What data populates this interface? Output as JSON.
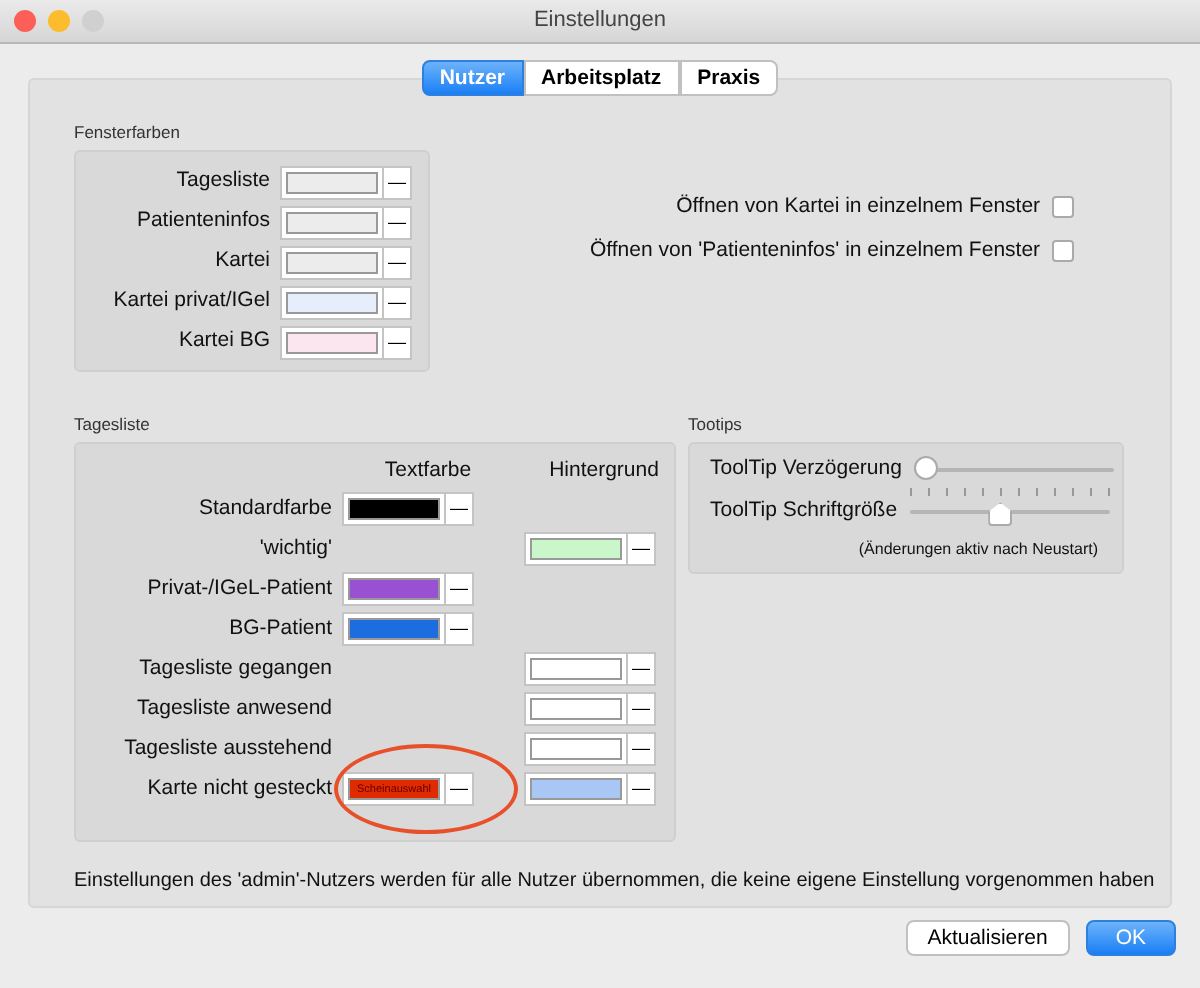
{
  "window": {
    "title": "Einstellungen"
  },
  "tabs": [
    {
      "label": "Nutzer",
      "selected": true
    },
    {
      "label": "Arbeitsplatz",
      "selected": false
    },
    {
      "label": "Praxis",
      "selected": false
    }
  ],
  "fensterfarben": {
    "title": "Fensterfarben",
    "rows": [
      {
        "label": "Tagesliste",
        "color": "#ececec",
        "button": "—"
      },
      {
        "label": "Patienteninfos",
        "color": "#ececec",
        "button": "—"
      },
      {
        "label": "Kartei",
        "color": "#ececec",
        "button": "—"
      },
      {
        "label": "Kartei privat/IGel",
        "color": "#e6eefb",
        "button": "—"
      },
      {
        "label": "Kartei BG",
        "color": "#fbe6ef",
        "button": "—"
      }
    ]
  },
  "options": [
    {
      "label": "Öffnen von Kartei in einzelnem Fenster",
      "checked": false
    },
    {
      "label": "Öffnen von 'Patienteninfos' in einzelnem Fenster",
      "checked": false
    }
  ],
  "tagesliste": {
    "title": "Tagesliste",
    "columns": [
      "Textfarbe",
      "Hintergrund"
    ],
    "rows": [
      {
        "label": "Standardfarbe",
        "text_color": {
          "color": "#000000",
          "button": "—"
        },
        "background": null,
        "circled": false
      },
      {
        "label": "'wichtig'",
        "text_color": null,
        "background": {
          "color": "#c9f7c9",
          "button": "—"
        },
        "circled": false
      },
      {
        "label": "Privat-/IGeL-Patient",
        "text_color": {
          "color": "#9a50d2",
          "button": "—"
        },
        "background": null,
        "circled": false
      },
      {
        "label": "BG-Patient",
        "text_color": {
          "color": "#1c6ee0",
          "button": "—"
        },
        "background": null,
        "circled": false
      },
      {
        "label": "Tagesliste gegangen",
        "text_color": null,
        "background": {
          "color": "#ffffff",
          "button": "—"
        },
        "circled": false
      },
      {
        "label": "Tagesliste anwesend",
        "text_color": null,
        "background": {
          "color": "#ffffff",
          "button": "—"
        },
        "circled": false
      },
      {
        "label": "Tagesliste ausstehend",
        "text_color": null,
        "background": {
          "color": "#ffffff",
          "button": "—"
        },
        "circled": false
      },
      {
        "label": "Karte nicht gesteckt",
        "text_color": {
          "color": "#e02a00",
          "text": "Scheinauswahl",
          "button": "—"
        },
        "background": {
          "color": "#a9c7f5",
          "button": "—"
        },
        "circled": true
      }
    ]
  },
  "tooltips": {
    "title": "Tootips",
    "sliders": [
      {
        "label": "ToolTip Verzögerung",
        "kind": "plain",
        "level": 0.0
      },
      {
        "label": "ToolTip Schriftgröße",
        "kind": "ticked",
        "level": 0.45
      }
    ],
    "note": "(Änderungen aktiv nach Neustart)"
  },
  "footer_note": "Einstellungen des 'admin'-Nutzers werden für alle Nutzer übernommen, die keine eigene Einstellung vorgenommen haben",
  "buttons": [
    {
      "label": "Aktualisieren",
      "kind": "default"
    },
    {
      "label": "OK",
      "kind": "primary"
    }
  ]
}
